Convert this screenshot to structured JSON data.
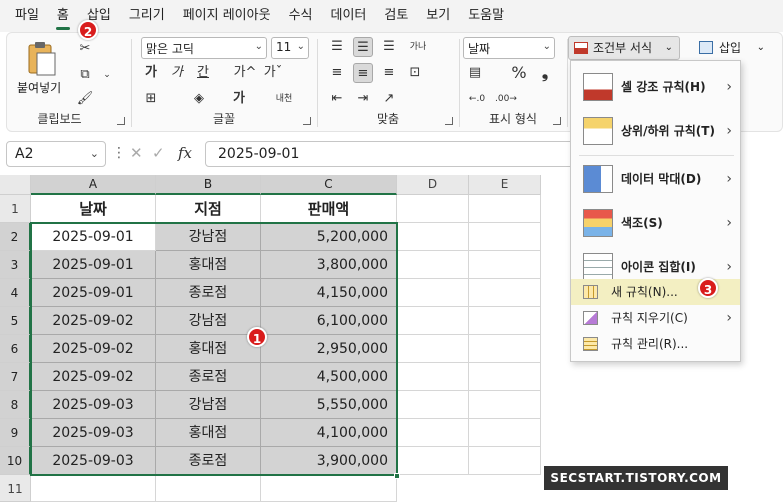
{
  "menu": [
    "파일",
    "홈",
    "삽입",
    "그리기",
    "페이지 레이아웃",
    "수식",
    "데이터",
    "검토",
    "보기",
    "도움말"
  ],
  "ribbon": {
    "clipboard": {
      "paste_label": "붙여넣기",
      "group_label": "클립보드"
    },
    "font": {
      "font_name": "맑은 고딕",
      "font_size": "11",
      "bold": "가",
      "italic": "가",
      "underline": "간",
      "grow": "가^",
      "shrink": "가ˇ",
      "color_a": "가",
      "phonetic": "내천",
      "group_label": "글꼴"
    },
    "alignment": {
      "wrap": "가나",
      "group_label": "맞춤"
    },
    "number": {
      "format": "날짜",
      "percent": "%",
      "comma": "❟",
      "group_label": "표시 형식"
    },
    "styles": {
      "conditional_format": "조건부 서식"
    },
    "cells": {
      "insert": "삽입"
    }
  },
  "formula_bar": {
    "name_box": "A2",
    "fx": "fx",
    "formula": "2025-09-01"
  },
  "grid": {
    "columns": [
      "A",
      "B",
      "C",
      "D",
      "E"
    ],
    "rows": [
      "1",
      "2",
      "3",
      "4",
      "5",
      "6",
      "7",
      "8",
      "9",
      "10",
      "11"
    ],
    "headers": [
      "날짜",
      "지점",
      "판매액"
    ],
    "data": [
      [
        "2025-09-01",
        "강남점",
        "5,200,000"
      ],
      [
        "2025-09-01",
        "홍대점",
        "3,800,000"
      ],
      [
        "2025-09-01",
        "종로점",
        "4,150,000"
      ],
      [
        "2025-09-02",
        "강남점",
        "6,100,000"
      ],
      [
        "2025-09-02",
        "홍대점",
        "2,950,000"
      ],
      [
        "2025-09-02",
        "종로점",
        "4,500,000"
      ],
      [
        "2025-09-03",
        "강남점",
        "5,550,000"
      ],
      [
        "2025-09-03",
        "홍대점",
        "4,100,000"
      ],
      [
        "2025-09-03",
        "종로점",
        "3,900,000"
      ]
    ]
  },
  "dropdown": {
    "highlight_rules": "셀 강조 규칙(H)",
    "top_bottom": "상위/하위 규칙(T)",
    "data_bars": "데이터 막대(D)",
    "color_scales": "색조(S)",
    "icon_sets": "아이콘 집합(I)",
    "new_rule": "새 규칙(N)...",
    "clear_rules": "규칙 지우기(C)",
    "manage_rules": "규칙 관리(R)..."
  },
  "badges": {
    "one": "1",
    "two": "2",
    "three": "3"
  },
  "watermark": "SECSTART.TISTORY.COM",
  "colors": {
    "accent": "#217346",
    "selection": "#d3d3d3",
    "badge": "#d91c1c",
    "hover": "#f3efc2"
  }
}
